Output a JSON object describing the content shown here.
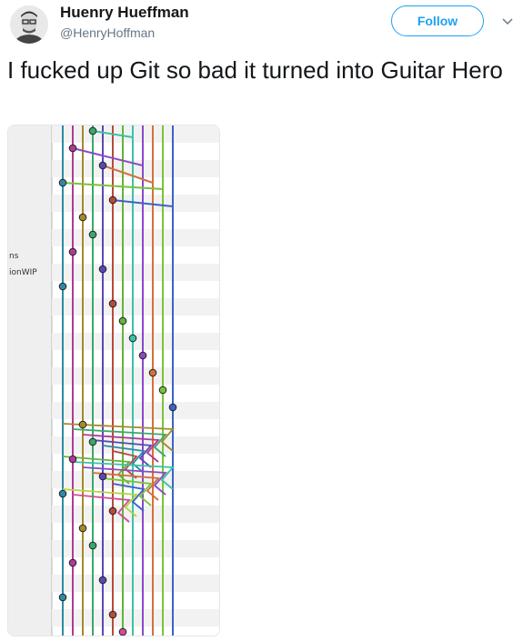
{
  "author": {
    "display_name": "Huenry Hueffman",
    "handle": "@HenryHoffman"
  },
  "follow_label": "Follow",
  "tweet": {
    "text": "I fucked up Git so bad it turned into Guitar Hero"
  },
  "graph": {
    "branch_labels": [
      "ns",
      "ionWIP"
    ],
    "colors": {
      "teal": "#2e8aa8",
      "magenta": "#b03a94",
      "olive": "#a58a2a",
      "green": "#3aa86b",
      "purple": "#5a48b5",
      "red": "#b84a3a",
      "lime": "#62b43a",
      "aqua": "#3ac2a8",
      "violet": "#8a4ac8",
      "orange": "#d4703a",
      "leaf": "#7ac23a",
      "blue": "#3a62c8",
      "yellowgreen": "#b4d43a",
      "pink": "#d44a9a"
    }
  }
}
